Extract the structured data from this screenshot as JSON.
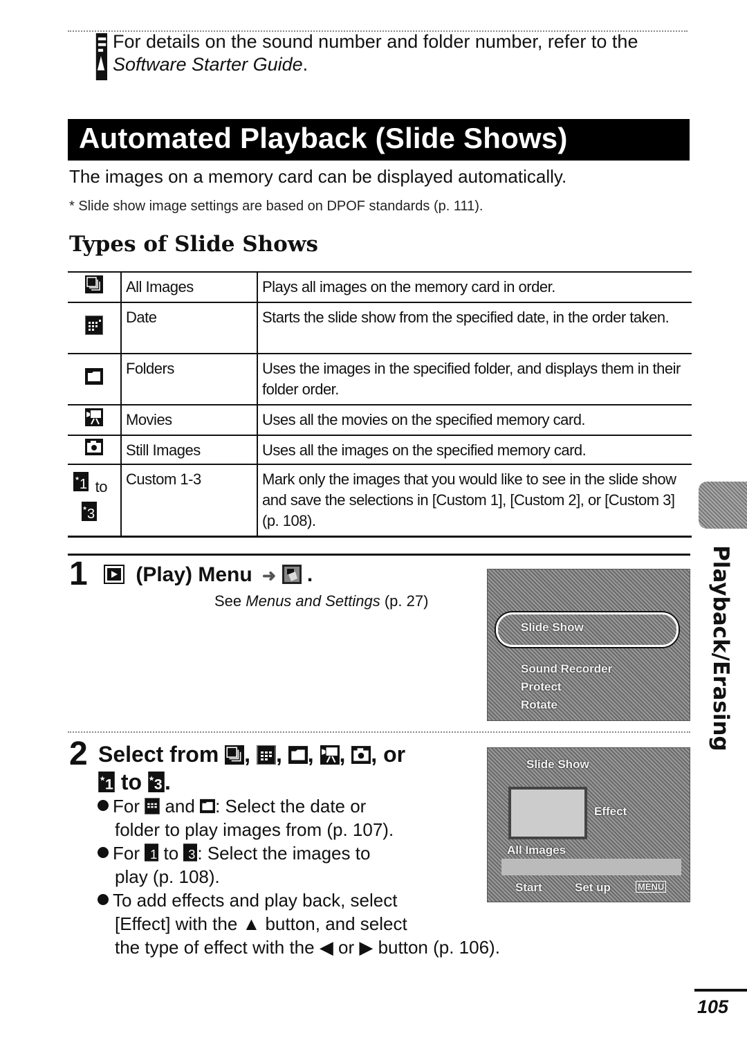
{
  "note": {
    "icon": "memo-pencil-icon",
    "text_line1": "For details on the sound number and folder number, refer to the",
    "text_line2_italic": "Software Starter Guide",
    "text_line2_end": "."
  },
  "title": "Automated Playback (Slide Shows)",
  "intro": "The images on a memory card can be displayed automatically.",
  "footnote": "* Slide show image settings are based on DPOF standards (p. 111).",
  "section_heading": "Types of Slide Shows",
  "table": {
    "rows": [
      {
        "icon": "all-images-icon",
        "name": "All Images",
        "description": "Plays all images on the memory card in order."
      },
      {
        "icon": "date-calendar-icon",
        "name": "Date",
        "description": "Starts the slide show from the specified date, in the order taken."
      },
      {
        "icon": "folder-icon",
        "name": "Folders",
        "description": "Uses the images in the specified folder, and displays them in their folder order."
      },
      {
        "icon": "movie-camera-icon",
        "name": "Movies",
        "description": "Uses all the movies on the specified memory card."
      },
      {
        "icon": "still-camera-icon",
        "name": "Still Images",
        "description": "Uses all the images on the specified memory card."
      },
      {
        "icon": "custom-1-to-3-icon",
        "name": "Custom 1-3",
        "description": "Mark only the images that you would like to see in the slide show and save the selections in [Custom 1], [Custom 2], or [Custom 3] (p. 108).",
        "icon_joiner": "to",
        "icon_start": "1",
        "icon_end": "3"
      }
    ]
  },
  "step1": {
    "number": "1",
    "title_play": "(Play) Menu",
    "arrow": "➜",
    "period": ".",
    "sub_prefix": "See ",
    "sub_italic": "Menus and Settings",
    "sub_suffix": " (p. 27)",
    "screen": {
      "items": [
        "Slide Show",
        "Sound Recorder",
        "Protect",
        "Rotate"
      ],
      "selected": "Slide Show"
    }
  },
  "step2": {
    "number": "2",
    "title_prefix": "Select from",
    "title_or": ", or",
    "title_to": "to",
    "bullets": [
      {
        "line1": "For",
        "mid": "and",
        "line1_end": ": Select the date or",
        "line2": "folder to play images from (p. 107)."
      },
      {
        "line1": "For",
        "mid": "to",
        "line1_end": ": Select the images to",
        "line2": "play (p. 108)."
      },
      {
        "line1": "To add effects and play back, select",
        "line2": "[Effect] with the ▲ button, and select",
        "line3": "the type of effect with the ◀ or ▶ button (p. 106)."
      }
    ],
    "screen": {
      "title": "Slide Show",
      "effect_label": "Effect",
      "mode_label": "All Images",
      "start_label": "Start",
      "setup_label": "Set up",
      "menu_label": "MENU"
    }
  },
  "side_tab": "Playback/Erasing",
  "page_number": "105"
}
